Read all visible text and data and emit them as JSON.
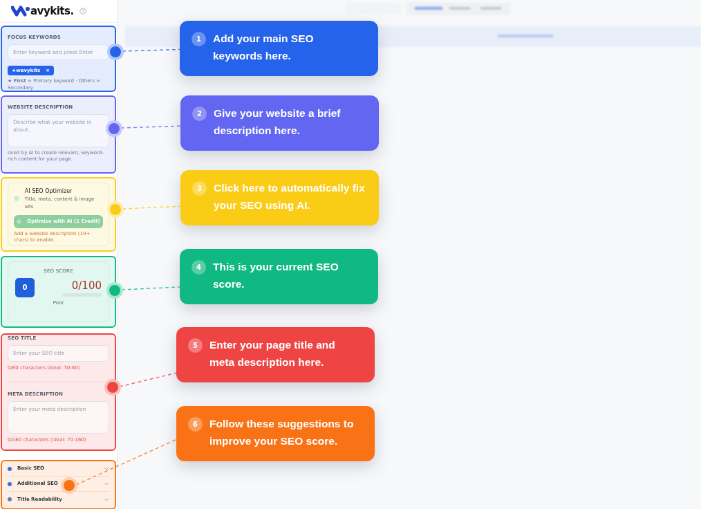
{
  "logo": {
    "text": "avykits."
  },
  "sections": [
    {
      "kind": "keywords",
      "color": "#2563eb",
      "label": "FOCUS KEYWORDS",
      "placeholder": "Enter keyword and press Enter",
      "tags": [
        {
          "text": "★wavykits",
          "remove": "×"
        }
      ],
      "hint": "**★ First** = Primary keyword · Others = Secondary"
    },
    {
      "kind": "description",
      "color": "#6366f1",
      "label": "WEBSITE DESCRIPTION",
      "placeholder": "Describe what your website is about...",
      "hint": "Used by AI to create relevant, keyword-rich content for your page."
    },
    {
      "kind": "optimizer",
      "color": "#facc15",
      "title": "AI SEO Optimizer",
      "subtitle": "Title, meta, content & image alts",
      "button": "Optimize with AI (1 Credit)",
      "disabled": true,
      "note": "Add a website description (10+ chars) to enable."
    },
    {
      "kind": "score",
      "color": "#10b981",
      "label": "SEO SCORE",
      "badge": "0",
      "value": "0/100",
      "level": 0,
      "rating": "Poor"
    },
    {
      "kind": "meta",
      "color": "#ef4444",
      "fields": [
        {
          "label": "SEO TITLE",
          "placeholder": "Enter your SEO title",
          "counter": "0/60 characters (ideal: 30-60)",
          "multiline": false
        },
        {
          "label": "META DESCRIPTION",
          "placeholder": "Enter your meta description",
          "counter": "0/160 characters (ideal: 70-160)",
          "multiline": true
        }
      ]
    },
    {
      "kind": "checks",
      "color": "#f97316",
      "items": [
        {
          "label": "Basic SEO",
          "color": "#3b6fd8",
          "expanded": false
        },
        {
          "label": "Additional SEO",
          "color": "#3b6fd8",
          "expanded": false
        },
        {
          "label": "Title Readability",
          "color": "#6b7a99",
          "expanded": false
        }
      ]
    }
  ],
  "callouts": [
    {
      "number": "1",
      "text": "Add your main SEO keywords here.",
      "color": "#2563eb"
    },
    {
      "number": "2",
      "text": "Give your website a brief description here.",
      "color": "#6366f1"
    },
    {
      "number": "3",
      "text": "Click here to automatically fix your SEO using AI.",
      "color": "#facc15"
    },
    {
      "number": "4",
      "text": "This is your current SEO score.",
      "color": "#10b981"
    },
    {
      "number": "5",
      "text": "Enter your page title and meta description here.",
      "color": "#ef4444"
    },
    {
      "number": "6",
      "text": "Follow these suggestions to improve your SEO score.",
      "color": "#f97316"
    }
  ]
}
